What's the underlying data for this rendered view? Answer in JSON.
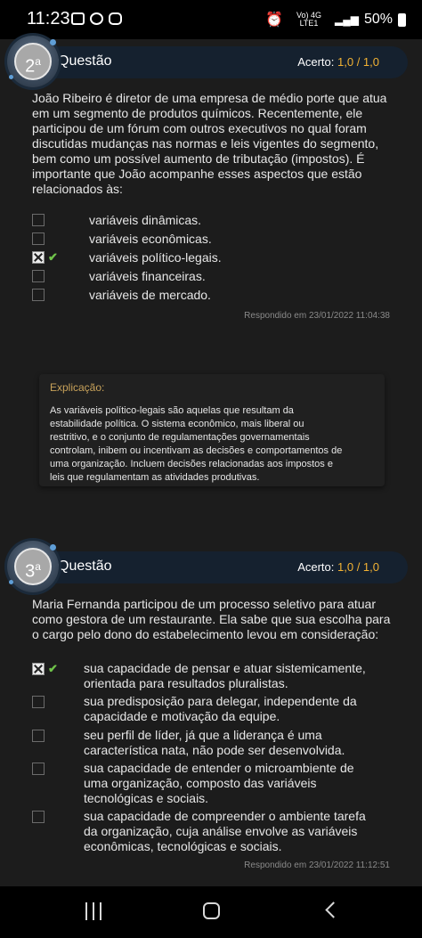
{
  "status_bar": {
    "time": "11:23",
    "network": "Vo) 4G LTE1",
    "battery": "50%"
  },
  "question2": {
    "number": "2",
    "ordinal": "a",
    "label": "Questão",
    "score_label": "Acerto:",
    "score": "1,0",
    "score_total": "/ 1,0",
    "prompt": "João Ribeiro é diretor de uma empresa de médio porte que atua em um segmento de produtos químicos. Recentemente, ele participou de um fórum com outros executivos no qual foram discutidas mudanças nas normas e leis vigentes do segmento, bem como um possível aumento de tributação (impostos). É importante que João acompanhe esses aspectos que estão relacionados às:",
    "options": [
      {
        "label": "variáveis dinâmicas.",
        "checked": false
      },
      {
        "label": "variáveis econômicas.",
        "checked": false
      },
      {
        "label": "variáveis político-legais.",
        "checked": true
      },
      {
        "label": "variáveis financeiras.",
        "checked": false
      },
      {
        "label": "variáveis de mercado.",
        "checked": false
      }
    ],
    "answered": "Respondido em 23/01/2022 11:04:38",
    "explanation_title": "Explicação:",
    "explanation": "As variáveis político-legais são aquelas que resultam da estabilidade política. O sistema econômico, mais liberal ou restritivo, e o conjunto de regulamentações governamentais controlam, inibem ou incentivam as decisões e comportamentos de uma organização. Incluem decisões relacionadas aos impostos e leis que regulamentam as atividades produtivas."
  },
  "question3": {
    "number": "3",
    "ordinal": "a",
    "label": "Questão",
    "score_label": "Acerto:",
    "score": "1,0",
    "score_total": "/ 1,0",
    "prompt": "Maria Fernanda participou de um processo seletivo para atuar como gestora de um restaurante. Ela sabe que sua escolha para o cargo pelo dono do estabelecimento levou em consideração:",
    "options": [
      {
        "label": "sua capacidade de pensar e atuar sistemicamente, orientada para resultados pluralistas.",
        "checked": true
      },
      {
        "label": "sua predisposição para delegar, independente da capacidade e motivação da equipe.",
        "checked": false
      },
      {
        "label": "seu perfil de líder, já que a liderança é uma característica nata, não pode ser desenvolvida.",
        "checked": false
      },
      {
        "label": "sua capacidade de entender o microambiente de uma organização, composto das variáveis tecnológicas e sociais.",
        "checked": false
      },
      {
        "label": "sua capacidade de compreender o ambiente tarefa da organização, cuja análise envolve as variáveis econômicas, tecnológicas e sociais.",
        "checked": false
      }
    ],
    "answered": "Respondido em 23/01/2022 11:12:51"
  },
  "colors": {
    "accent": "#f2b233",
    "check": "#6fc34a",
    "header": "#15212f"
  }
}
